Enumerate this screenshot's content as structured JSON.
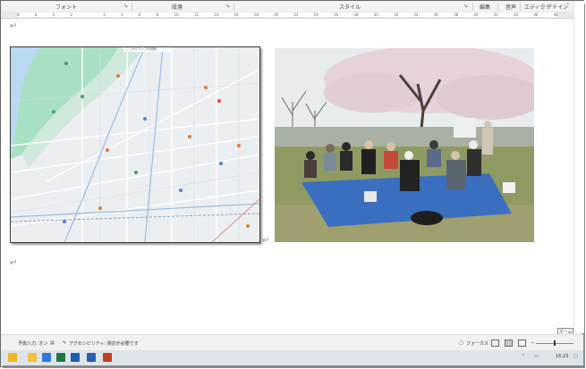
{
  "ribbon": {
    "groups": [
      "フォント",
      "段落",
      "スタイル",
      "編集",
      "音声",
      "エディター",
      "アドイン"
    ],
    "launcher_glyph": "↘"
  },
  "ruler": {
    "numbers": [
      "8",
      "6",
      "4",
      "2",
      "",
      "2",
      "4",
      "6",
      "8",
      "10",
      "12",
      "14",
      "16",
      "18",
      "20",
      "22",
      "24",
      "26",
      "28",
      "30",
      "32",
      "34",
      "36",
      "38",
      "40",
      "42",
      "44",
      "46",
      "48"
    ]
  },
  "document": {
    "paragraph_mark": "↵",
    "map_search_text": "ここからマップを検索"
  },
  "zoom_popup": "ズーム",
  "statusbar": {
    "prediction": "予測入力: オン",
    "accessibility": "アクセシビリティ: 検討が必要です",
    "focus": "フォーカス"
  },
  "taskbar": {
    "time": "16:23"
  },
  "colors": {
    "ribbon_bg": "#f3f3f3",
    "status_bg": "#f1f1f1",
    "taskbar_bg": "#dfe4ea",
    "tarp_blue": "#3a6fc0",
    "blossom": "#e8d6dc",
    "map_green": "#9fdcc0"
  }
}
